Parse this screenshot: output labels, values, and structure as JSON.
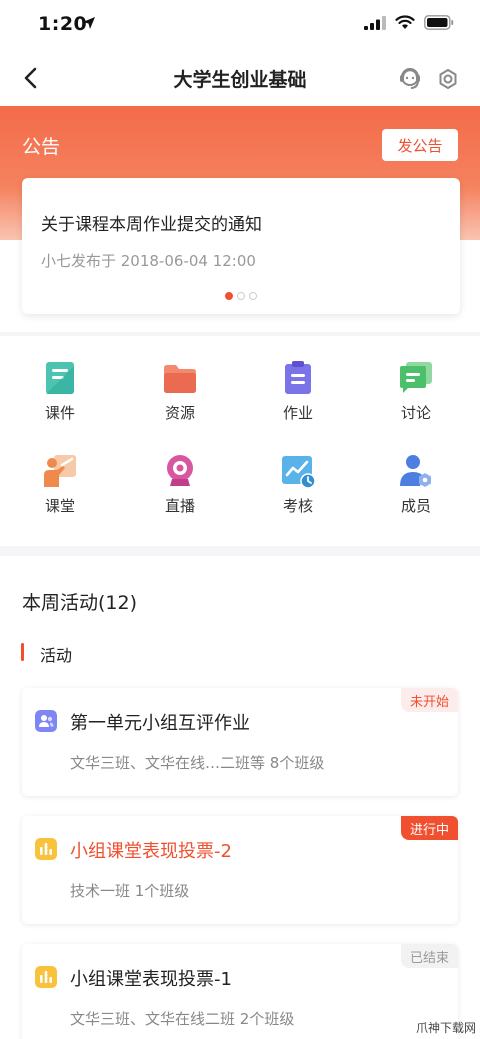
{
  "status_bar": {
    "time": "1:20"
  },
  "nav": {
    "title": "大学生创业基础"
  },
  "notice": {
    "label": "公告",
    "post_button": "发公告",
    "card_title": "关于课程本周作业提交的通知",
    "card_meta": "小七发布于 2018-06-04 12:00"
  },
  "grid": [
    {
      "label": "课件",
      "icon": "courseware-icon"
    },
    {
      "label": "资源",
      "icon": "folder-icon"
    },
    {
      "label": "作业",
      "icon": "homework-clipboard-icon"
    },
    {
      "label": "讨论",
      "icon": "discussion-icon"
    },
    {
      "label": "课堂",
      "icon": "classroom-icon"
    },
    {
      "label": "直播",
      "icon": "live-camera-icon"
    },
    {
      "label": "考核",
      "icon": "assessment-icon"
    },
    {
      "label": "成员",
      "icon": "members-icon"
    }
  ],
  "activities": {
    "week_title": "本周活动(12)",
    "section_label": "活动",
    "items": [
      {
        "name": "第一单元小组互评作业",
        "classes": "文华三班、文华在线…二班等 8个班级",
        "status": "未开始",
        "icon": "peer-review-icon"
      },
      {
        "name": "小组课堂表现投票-2",
        "classes": "技术一班 1个班级",
        "status": "进行中",
        "icon": "vote-icon"
      },
      {
        "name": "小组课堂表现投票-1",
        "classes": "文华三班、文华在线二班 2个班级",
        "status": "已结束",
        "icon": "vote-icon"
      }
    ]
  },
  "watermark": "爪神下载网",
  "colors": {
    "accent": "#f0502f",
    "banner_top": "#f46b4a"
  }
}
